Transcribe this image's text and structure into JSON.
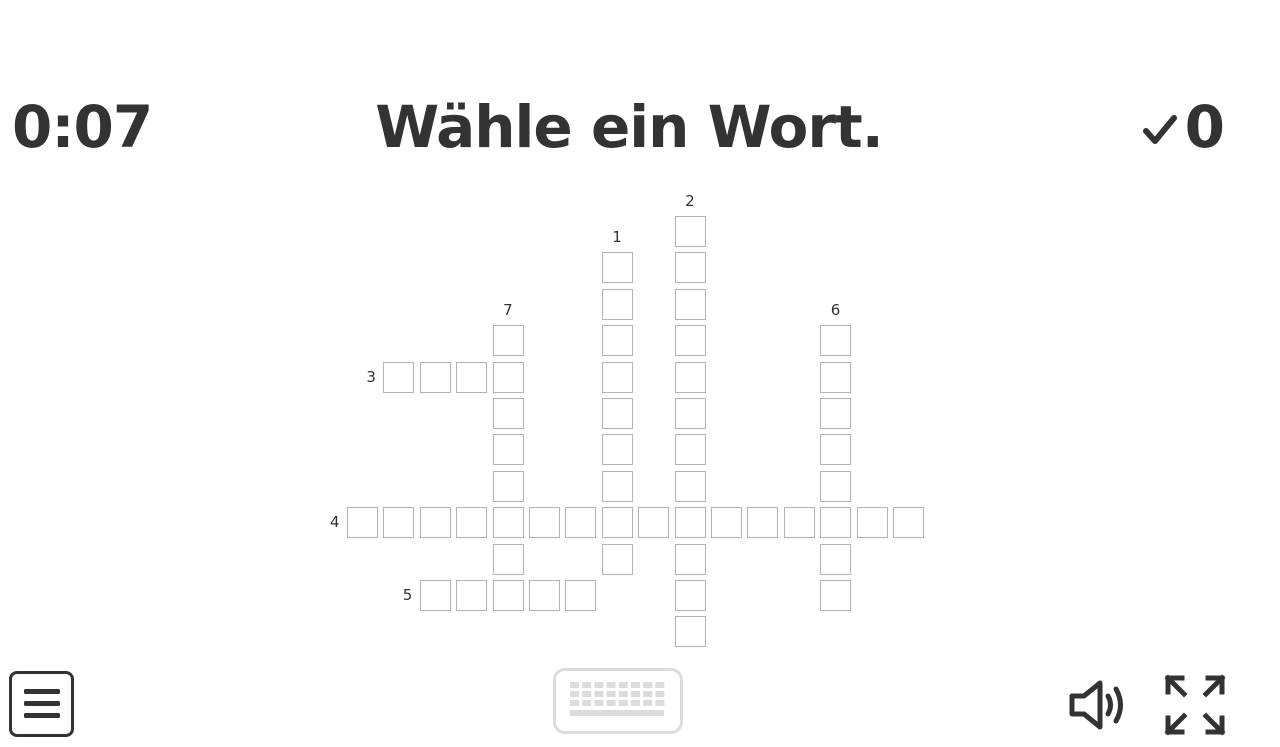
{
  "header": {
    "timer": "0:07",
    "instruction": "Wähle ein Wort.",
    "correct_count": "0"
  },
  "crossword": {
    "clues": [
      {
        "number": "1",
        "direction": "down",
        "row": 1,
        "col": 7,
        "length": 9
      },
      {
        "number": "2",
        "direction": "down",
        "row": 0,
        "col": 9,
        "length": 12
      },
      {
        "number": "3",
        "direction": "across",
        "row": 4,
        "col": 1,
        "length": 4
      },
      {
        "number": "4",
        "direction": "across",
        "row": 8,
        "col": 0,
        "length": 16
      },
      {
        "number": "5",
        "direction": "across",
        "row": 10,
        "col": 2,
        "length": 5
      },
      {
        "number": "6",
        "direction": "down",
        "row": 3,
        "col": 13,
        "length": 8
      },
      {
        "number": "7",
        "direction": "down",
        "row": 3,
        "col": 4,
        "length": 7
      }
    ]
  },
  "footer": {
    "menu_icon": "hamburger-icon",
    "keyboard_icon": "keyboard-icon",
    "sound_icon": "speaker-icon",
    "fullscreen_icon": "fullscreen-icon"
  }
}
